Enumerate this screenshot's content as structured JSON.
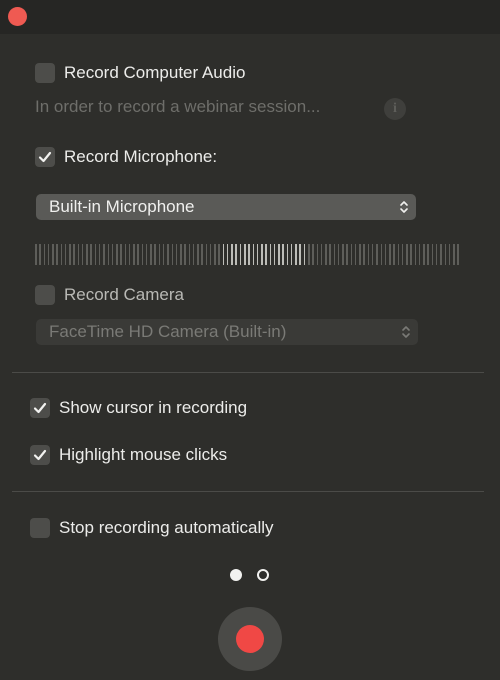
{
  "window": {
    "close_button_color": "#ef5a52"
  },
  "options": {
    "computer_audio": {
      "label": "Record Computer Audio",
      "checked": false
    },
    "webinar_hint": "In order to record a webinar session...",
    "microphone": {
      "label": "Record Microphone:",
      "checked": true
    },
    "microphone_select": {
      "value": "Built-in Microphone"
    },
    "audio_level": {
      "active_bars_from": 44,
      "active_bars_to": 64,
      "total_bars": 100
    },
    "camera": {
      "label": "Record Camera",
      "checked": false
    },
    "camera_select": {
      "value": "FaceTime HD Camera (Built-in)"
    },
    "show_cursor": {
      "label": "Show cursor in recording",
      "checked": true
    },
    "highlight_clicks": {
      "label": "Highlight mouse clicks",
      "checked": true
    },
    "stop_auto": {
      "label": "Stop recording automatically",
      "checked": false
    }
  },
  "pager": {
    "current_page": 1,
    "total_pages": 2
  },
  "record_button": {
    "color": "#f04845"
  }
}
